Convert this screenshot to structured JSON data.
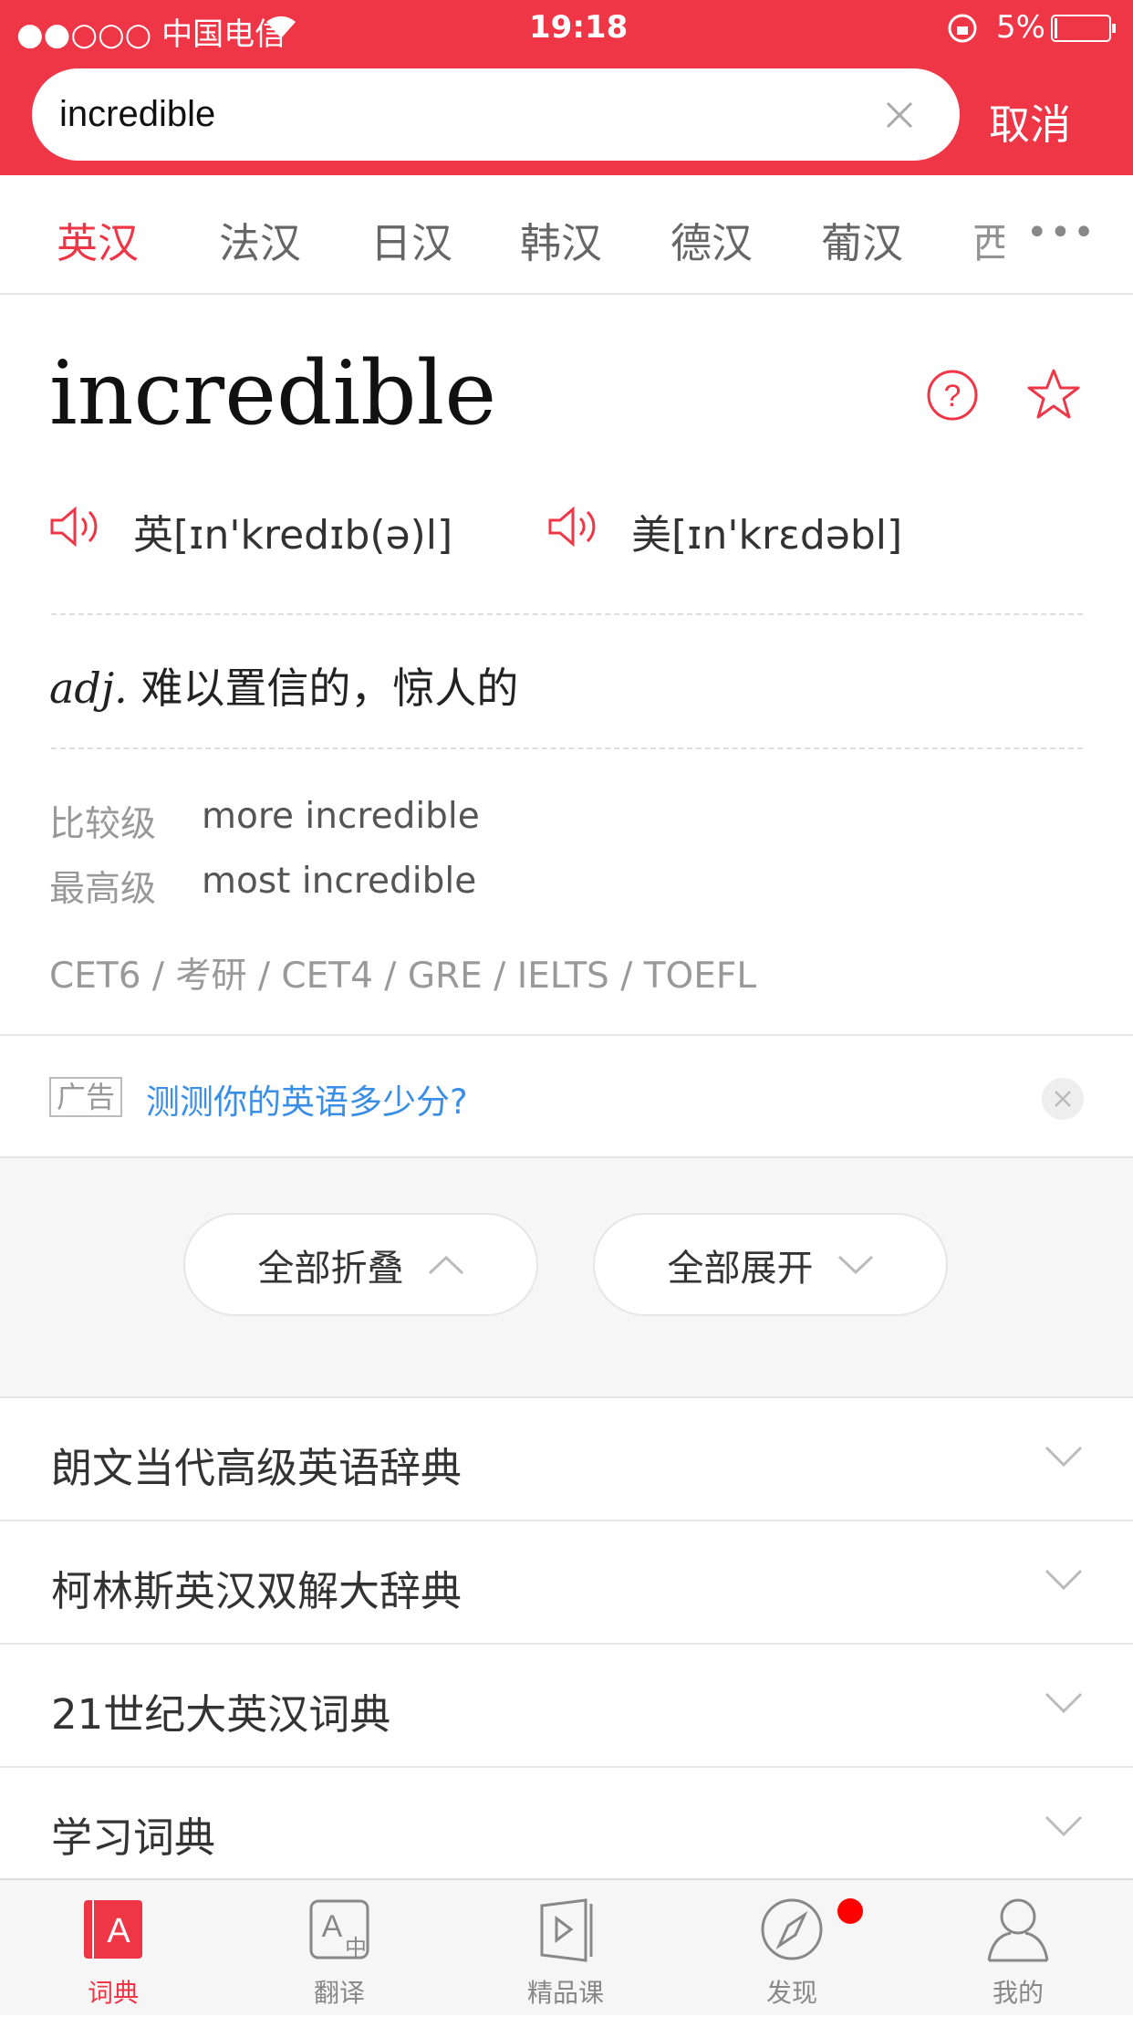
{
  "status_bar": {
    "carrier": "●●○○○ 中国电信",
    "time": "19:18",
    "battery": "5%"
  },
  "search": {
    "value": "incredible",
    "cancel_label": "取消"
  },
  "lang_tabs": [
    "英汉",
    "法汉",
    "日汉",
    "韩汉",
    "德汉",
    "葡汉",
    "西"
  ],
  "entry": {
    "word": "incredible",
    "uk_phonetic": "英[ɪn'kredɪb(ə)l]",
    "us_phonetic": "美[ɪn'krɛdəbl]",
    "pos": "adj.",
    "definition": "难以置信的，惊人的",
    "forms": [
      {
        "label": "比较级",
        "value": "more incredible"
      },
      {
        "label": "最高级",
        "value": "most incredible"
      }
    ],
    "exams": "CET6 / 考研 / CET4 / GRE / IELTS / TOEFL"
  },
  "ad": {
    "tag": "广告",
    "text": "测测你的英语多少分?"
  },
  "actions": {
    "collapse_all": "全部折叠",
    "expand_all": "全部展开"
  },
  "dictionaries": [
    "朗文当代高级英语辞典",
    "柯林斯英汉双解大辞典",
    "21世纪大英汉词典",
    "学习词典"
  ],
  "tabbar": [
    {
      "label": "词典",
      "icon": "dictionary-icon"
    },
    {
      "label": "翻译",
      "icon": "translate-icon"
    },
    {
      "label": "精品课",
      "icon": "course-icon"
    },
    {
      "label": "发现",
      "icon": "compass-icon"
    },
    {
      "label": "我的",
      "icon": "profile-icon"
    }
  ],
  "colors": {
    "accent": "#ef3646",
    "link": "#3a8ee6"
  }
}
